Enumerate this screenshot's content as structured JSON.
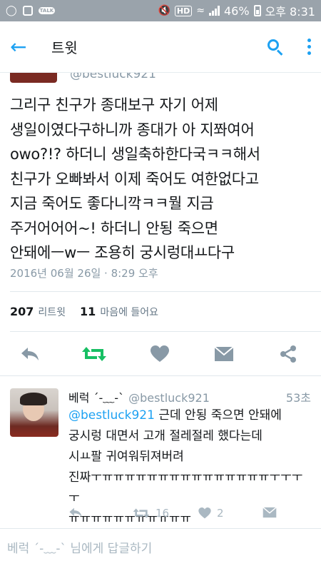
{
  "status_bar": {
    "talk_badge": "TALK",
    "hd_label": "HD",
    "battery": "46%",
    "time": "오후 8:31"
  },
  "header": {
    "title": "트윗",
    "icons": [
      "back-arrow-icon",
      "search-icon",
      "more-vertical-icon"
    ]
  },
  "prev_tweet": {
    "handle": "@bestluck921"
  },
  "tweet": {
    "text": "그리구 친구가 종대보구 자기 어제\n생일이였다구하니까 종대가 아 지쫘여어\nowo?!? 하더니 생일축하한다국ㅋㅋ해서\n친구가 오빠봐서 이제 죽어도 여한없다고\n지금 죽어도 좋다니깍ㅋㅋ뭘 지금\n주거어어어~! 하더니 안됭 죽으면\n안돼에ㅡwㅡ 조용히 궁시렁대ㅛ다구",
    "date": "2016년 06월 26일 · 8:29 오후",
    "retweets": "207",
    "retweets_label": "리트윗",
    "likes": "11",
    "likes_label": "마음에 들어요"
  },
  "actions": {
    "reply": "reply-icon",
    "retweet": "retweet-icon",
    "like": "heart-icon",
    "dm": "envelope-icon",
    "share": "share-icon"
  },
  "reply": {
    "name": "베럭 ˊ-﹏-ˋ",
    "handle": "@bestluck921",
    "time": "53초",
    "mention": "@bestluck921",
    "text": " 근데 안됭 죽으면 안돼에\n궁시렁 대면서 고개 절레절레 했다는데\n시ㅛ팔 귀여워뒤져버려\n진짜ㅜㅠㅠㅠㅠㅠㅠㅠㅠㅠㅠㅠㅠㅠㅠㅠㅜㅜㅜㅜ\nㅠㅠㅠㅠㅠㅠㅠㅠㅠㅠㅠ",
    "retweet_count": "16",
    "like_count": "2"
  },
  "compose": {
    "placeholder": "베럭 ˊ-﹏-ˋ 님에게 답글하기"
  },
  "colors": {
    "accent": "#1da1f2",
    "retweet_active": "#17bf63",
    "muted": "#8899a6",
    "status_bar": "#9aa3ab"
  }
}
